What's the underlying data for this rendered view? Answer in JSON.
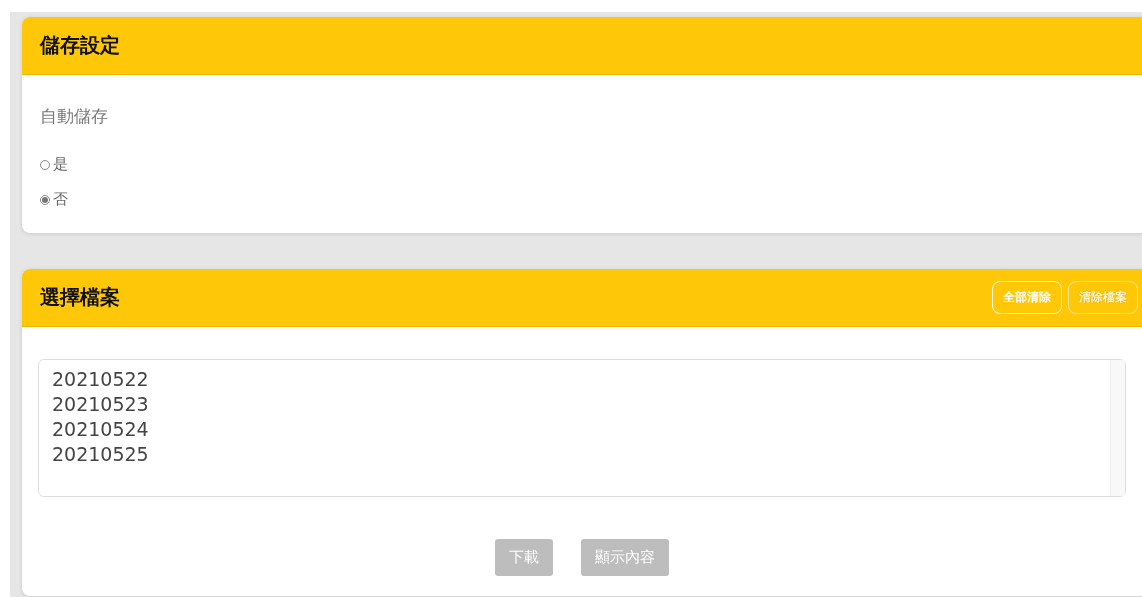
{
  "storage_settings": {
    "title": "儲存設定",
    "field_label": "自動儲存",
    "options": [
      {
        "label": "是",
        "selected": false
      },
      {
        "label": "否",
        "selected": true
      }
    ]
  },
  "file_selection": {
    "title": "選擇檔案",
    "header_buttons": [
      {
        "label": "全部清除",
        "disabled": false
      },
      {
        "label": "清除檔案",
        "disabled": true
      }
    ],
    "files": [
      "20210522",
      "20210523",
      "20210524",
      "20210525"
    ],
    "footer_buttons": [
      {
        "label": "下載",
        "disabled": true
      },
      {
        "label": "顯示內容",
        "disabled": true
      }
    ]
  }
}
